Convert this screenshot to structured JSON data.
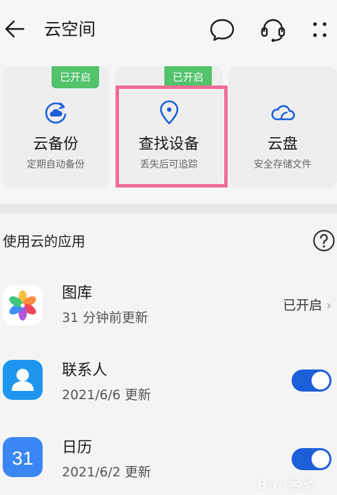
{
  "header": {
    "title": "云空间"
  },
  "cards": [
    {
      "title": "云备份",
      "subtitle": "定期自动备份",
      "badge": "已开启",
      "icon": "cloud-backup-icon"
    },
    {
      "title": "查找设备",
      "subtitle": "丢失后可追踪",
      "badge": "已开启",
      "icon": "location-pin-icon"
    },
    {
      "title": "云盘",
      "subtitle": "安全存储文件",
      "badge": "",
      "icon": "cloud-drive-icon"
    }
  ],
  "section": {
    "title": "使用云的应用"
  },
  "apps": [
    {
      "name": "图库",
      "subtitle": "31 分钟前更新",
      "status": "已开启",
      "icon": "gallery-icon"
    },
    {
      "name": "联系人",
      "subtitle": "2021/6/6 更新",
      "enabled": true,
      "icon": "contacts-icon"
    },
    {
      "name": "日历",
      "subtitle": "2021/6/2 更新",
      "enabled": true,
      "icon": "calendar-icon",
      "icon_text": "31"
    }
  ],
  "watermark": "Bai 经验",
  "colors": {
    "accent": "#1b5fd9",
    "badge": "#52c26b",
    "highlight": "#f06d95"
  }
}
